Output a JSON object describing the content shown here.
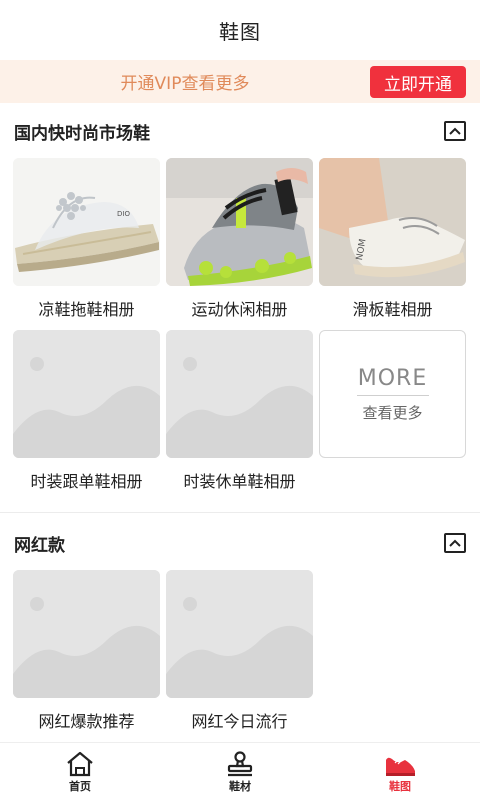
{
  "header": {
    "title": "鞋图"
  },
  "vip": {
    "text": "开通VIP查看更多",
    "button": "立即开通"
  },
  "sections": [
    {
      "title": "国内快时尚市场鞋",
      "items": [
        {
          "label": "凉鞋拖鞋相册",
          "image": "sandal-photo"
        },
        {
          "label": "运动休闲相册",
          "image": "sneaker-photo"
        },
        {
          "label": "滑板鞋相册",
          "image": "skate-shoe-photo"
        },
        {
          "label": "时装跟单鞋相册",
          "image": "placeholder"
        },
        {
          "label": "时装休单鞋相册",
          "image": "placeholder"
        }
      ],
      "more": {
        "big": "MORE",
        "small": "查看更多"
      }
    },
    {
      "title": "网红款",
      "items": [
        {
          "label": "网红爆款推荐",
          "image": "placeholder"
        },
        {
          "label": "网红今日流行",
          "image": "placeholder"
        }
      ]
    }
  ],
  "tabbar": [
    {
      "label": "首页",
      "icon": "home-icon",
      "active": false
    },
    {
      "label": "鞋材",
      "icon": "stamp-icon",
      "active": false
    },
    {
      "label": "鞋图",
      "icon": "shoe-icon",
      "active": true
    }
  ],
  "colors": {
    "accent": "#f0313d",
    "vip_bg": "#fdf1e8",
    "vip_text": "#e08a5a",
    "tab_active": "#e8323e"
  }
}
